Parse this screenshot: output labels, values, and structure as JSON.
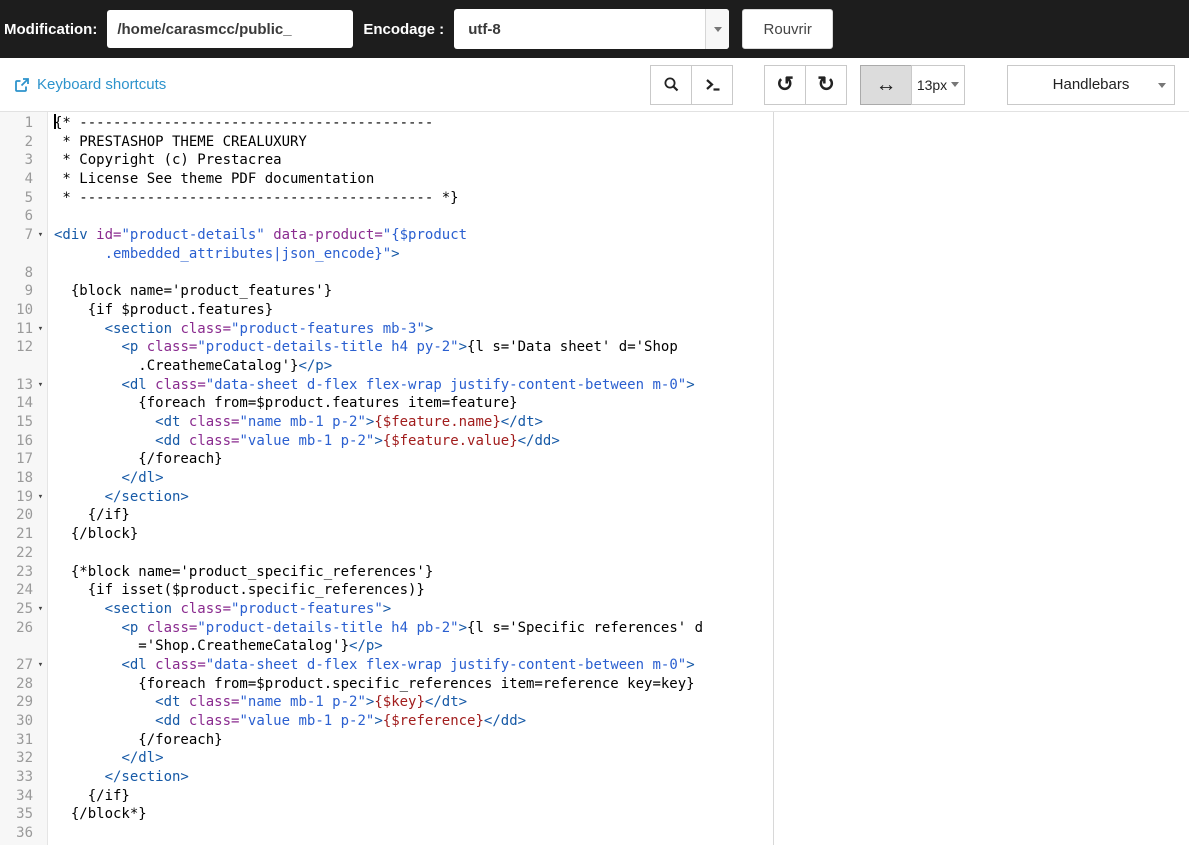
{
  "topbar": {
    "modification_label": "Modification:",
    "path_value": "/home/carasmcc/public_",
    "encoding_label": "Encodage :",
    "encoding_value": "utf-8",
    "reopen_label": "Rouvrir"
  },
  "toolbar": {
    "keyboard_shortcuts_label": "Keyboard shortcuts",
    "font_size_value": "13px",
    "syntax_value": "Handlebars",
    "icons": {
      "undo": "↺",
      "redo": "↻",
      "fullwidth": "↔"
    }
  },
  "colors": {
    "topbar_bg": "#1d1d1d",
    "link_blue": "#2d93cc",
    "token_tag": "#1659a6",
    "token_attr": "#8a2b8f",
    "token_string": "#2a5fd0",
    "token_variable": "#a11d1d",
    "line_number": "#9a9a9a",
    "active_button_bg": "#dcdcdc"
  },
  "editor": {
    "fold_icon": "▾",
    "lines": [
      {
        "n": 1,
        "cursor": true,
        "rows": [
          [
            [
              "cm",
              "{* ------------------------------------------"
            ]
          ]
        ]
      },
      {
        "n": 2,
        "rows": [
          [
            [
              "cm",
              " * PRESTASHOP THEME CREALUXURY"
            ]
          ]
        ]
      },
      {
        "n": 3,
        "rows": [
          [
            [
              "cm",
              " * Copyright (c) Prestacrea"
            ]
          ]
        ]
      },
      {
        "n": 4,
        "rows": [
          [
            [
              "cm",
              " * License See theme PDF documentation"
            ]
          ]
        ]
      },
      {
        "n": 5,
        "rows": [
          [
            [
              "cm",
              " * ------------------------------------------ *}"
            ]
          ]
        ]
      },
      {
        "n": 6,
        "rows": [
          []
        ]
      },
      {
        "n": 7,
        "fold": true,
        "rows": [
          [
            [
              "tag",
              "<div"
            ],
            [
              "pl",
              " "
            ],
            [
              "attr",
              "id="
            ],
            [
              "str",
              "\"product-details\""
            ],
            [
              "pl",
              " "
            ],
            [
              "attr",
              "data-product="
            ],
            [
              "str",
              "\"{$product"
            ]
          ],
          [
            [
              "str",
              "      .embedded_attributes|json_encode}\""
            ],
            [
              "tag",
              ">"
            ]
          ]
        ]
      },
      {
        "n": 8,
        "rows": [
          []
        ]
      },
      {
        "n": 9,
        "rows": [
          [
            [
              "pl",
              "  {block name='product_features'}"
            ]
          ]
        ]
      },
      {
        "n": 10,
        "rows": [
          [
            [
              "pl",
              "    {if $product.features}"
            ]
          ]
        ]
      },
      {
        "n": 11,
        "fold": true,
        "rows": [
          [
            [
              "pl",
              "      "
            ],
            [
              "tag",
              "<section"
            ],
            [
              "pl",
              " "
            ],
            [
              "attr",
              "class="
            ],
            [
              "str",
              "\"product-features mb-3\""
            ],
            [
              "tag",
              ">"
            ]
          ]
        ]
      },
      {
        "n": 12,
        "rows": [
          [
            [
              "pl",
              "        "
            ],
            [
              "tag",
              "<p"
            ],
            [
              "pl",
              " "
            ],
            [
              "attr",
              "class="
            ],
            [
              "str",
              "\"product-details-title h4 py-2\""
            ],
            [
              "tag",
              ">"
            ],
            [
              "pl",
              "{l s='Data sheet' d='Shop"
            ]
          ],
          [
            [
              "pl",
              "          .CreathemeCatalog'}"
            ],
            [
              "tag",
              "</p>"
            ]
          ]
        ]
      },
      {
        "n": 13,
        "fold": true,
        "rows": [
          [
            [
              "pl",
              "        "
            ],
            [
              "tag",
              "<dl"
            ],
            [
              "pl",
              " "
            ],
            [
              "attr",
              "class="
            ],
            [
              "str",
              "\"data-sheet d-flex flex-wrap justify-content-between m-0\""
            ],
            [
              "tag",
              ">"
            ]
          ]
        ]
      },
      {
        "n": 14,
        "rows": [
          [
            [
              "pl",
              "          {foreach from=$product.features item=feature}"
            ]
          ]
        ]
      },
      {
        "n": 15,
        "rows": [
          [
            [
              "pl",
              "            "
            ],
            [
              "tag",
              "<dt"
            ],
            [
              "pl",
              " "
            ],
            [
              "attr",
              "class="
            ],
            [
              "str",
              "\"name mb-1 p-2\""
            ],
            [
              "tag",
              ">"
            ],
            [
              "var",
              "{$feature.name}"
            ],
            [
              "tag",
              "</dt>"
            ]
          ]
        ]
      },
      {
        "n": 16,
        "rows": [
          [
            [
              "pl",
              "            "
            ],
            [
              "tag",
              "<dd"
            ],
            [
              "pl",
              " "
            ],
            [
              "attr",
              "class="
            ],
            [
              "str",
              "\"value mb-1 p-2\""
            ],
            [
              "tag",
              ">"
            ],
            [
              "var",
              "{$feature.value}"
            ],
            [
              "tag",
              "</dd>"
            ]
          ]
        ]
      },
      {
        "n": 17,
        "rows": [
          [
            [
              "pl",
              "          {/foreach}"
            ]
          ]
        ]
      },
      {
        "n": 18,
        "rows": [
          [
            [
              "pl",
              "        "
            ],
            [
              "tag",
              "</dl>"
            ]
          ]
        ]
      },
      {
        "n": 19,
        "fold": true,
        "rows": [
          [
            [
              "pl",
              "      "
            ],
            [
              "tag",
              "</section>"
            ]
          ]
        ]
      },
      {
        "n": 20,
        "rows": [
          [
            [
              "pl",
              "    {/if}"
            ]
          ]
        ]
      },
      {
        "n": 21,
        "rows": [
          [
            [
              "pl",
              "  {/block}"
            ]
          ]
        ]
      },
      {
        "n": 22,
        "rows": [
          []
        ]
      },
      {
        "n": 23,
        "rows": [
          [
            [
              "cm",
              "  {*block name='product_specific_references'}"
            ]
          ]
        ]
      },
      {
        "n": 24,
        "rows": [
          [
            [
              "pl",
              "    {if isset($product.specific_references)}"
            ]
          ]
        ]
      },
      {
        "n": 25,
        "fold": true,
        "rows": [
          [
            [
              "pl",
              "      "
            ],
            [
              "tag",
              "<section"
            ],
            [
              "pl",
              " "
            ],
            [
              "attr",
              "class="
            ],
            [
              "str",
              "\"product-features\""
            ],
            [
              "tag",
              ">"
            ]
          ]
        ]
      },
      {
        "n": 26,
        "rows": [
          [
            [
              "pl",
              "        "
            ],
            [
              "tag",
              "<p"
            ],
            [
              "pl",
              " "
            ],
            [
              "attr",
              "class="
            ],
            [
              "str",
              "\"product-details-title h4 pb-2\""
            ],
            [
              "tag",
              ">"
            ],
            [
              "pl",
              "{l s='Specific references' d"
            ]
          ],
          [
            [
              "pl",
              "          ='Shop.CreathemeCatalog'}"
            ],
            [
              "tag",
              "</p>"
            ]
          ]
        ]
      },
      {
        "n": 27,
        "fold": true,
        "rows": [
          [
            [
              "pl",
              "        "
            ],
            [
              "tag",
              "<dl"
            ],
            [
              "pl",
              " "
            ],
            [
              "attr",
              "class="
            ],
            [
              "str",
              "\"data-sheet d-flex flex-wrap justify-content-between m-0\""
            ],
            [
              "tag",
              ">"
            ]
          ]
        ]
      },
      {
        "n": 28,
        "rows": [
          [
            [
              "pl",
              "          {foreach from=$product.specific_references item=reference key=key}"
            ]
          ]
        ]
      },
      {
        "n": 29,
        "rows": [
          [
            [
              "pl",
              "            "
            ],
            [
              "tag",
              "<dt"
            ],
            [
              "pl",
              " "
            ],
            [
              "attr",
              "class="
            ],
            [
              "str",
              "\"name mb-1 p-2\""
            ],
            [
              "tag",
              ">"
            ],
            [
              "var",
              "{$key}"
            ],
            [
              "tag",
              "</dt>"
            ]
          ]
        ]
      },
      {
        "n": 30,
        "rows": [
          [
            [
              "pl",
              "            "
            ],
            [
              "tag",
              "<dd"
            ],
            [
              "pl",
              " "
            ],
            [
              "attr",
              "class="
            ],
            [
              "str",
              "\"value mb-1 p-2\""
            ],
            [
              "tag",
              ">"
            ],
            [
              "var",
              "{$reference}"
            ],
            [
              "tag",
              "</dd>"
            ]
          ]
        ]
      },
      {
        "n": 31,
        "rows": [
          [
            [
              "pl",
              "          {/foreach}"
            ]
          ]
        ]
      },
      {
        "n": 32,
        "rows": [
          [
            [
              "pl",
              "        "
            ],
            [
              "tag",
              "</dl>"
            ]
          ]
        ]
      },
      {
        "n": 33,
        "rows": [
          [
            [
              "pl",
              "      "
            ],
            [
              "tag",
              "</section>"
            ]
          ]
        ]
      },
      {
        "n": 34,
        "rows": [
          [
            [
              "pl",
              "    {/if}"
            ]
          ]
        ]
      },
      {
        "n": 35,
        "rows": [
          [
            [
              "pl",
              "  {/block*}"
            ]
          ]
        ]
      },
      {
        "n": 36,
        "rows": [
          []
        ]
      }
    ]
  }
}
